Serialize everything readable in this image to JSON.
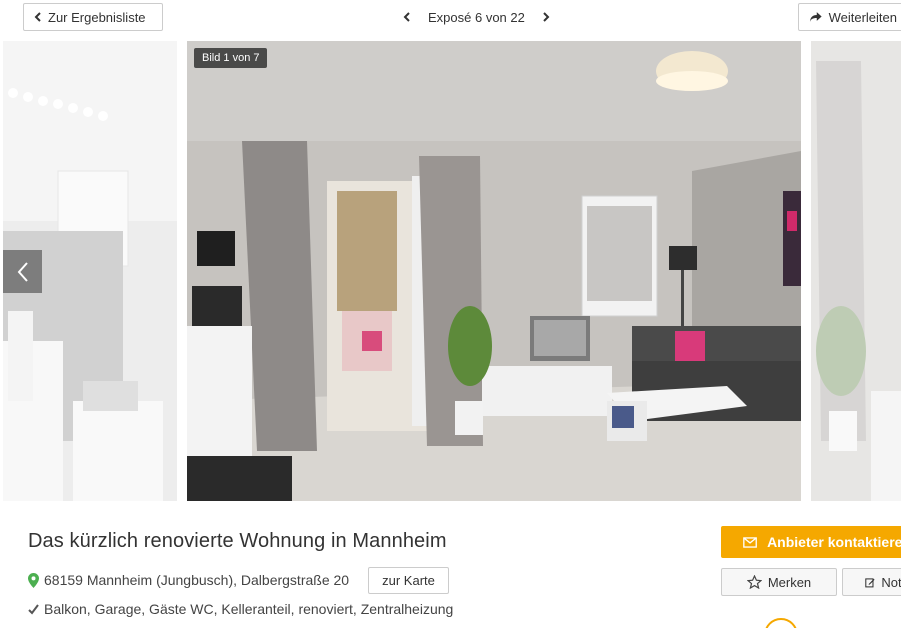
{
  "nav": {
    "back_label": "Zur Ergebnisliste",
    "pager_label": "Exposé 6 von 22",
    "share_label": "Weiterleiten"
  },
  "gallery": {
    "counter": "Bild 1 von 7"
  },
  "listing": {
    "title": "Das kürzlich renovierte Wohnung in Mannheim",
    "address": "68159 Mannheim (Jungbusch), Dalbergstraße 20",
    "map_button": "zur Karte",
    "features": "Balkon, Garage, Gäste WC, Kelleranteil, renoviert, Zentralheizung"
  },
  "actions": {
    "contact_label": "Anbieter kontaktieren",
    "save_label": "Merken",
    "note_label": "Notiz"
  },
  "colors": {
    "accent": "#f5a800",
    "pin": "#4caf50"
  },
  "icons": {
    "back": "chevron-left-icon",
    "pager_prev": "chevron-left-icon",
    "pager_next": "chevron-right-icon",
    "share": "share-arrow-icon",
    "pin": "map-pin-icon",
    "check": "check-icon",
    "mail": "envelope-icon",
    "star": "star-icon",
    "note": "edit-note-icon"
  }
}
